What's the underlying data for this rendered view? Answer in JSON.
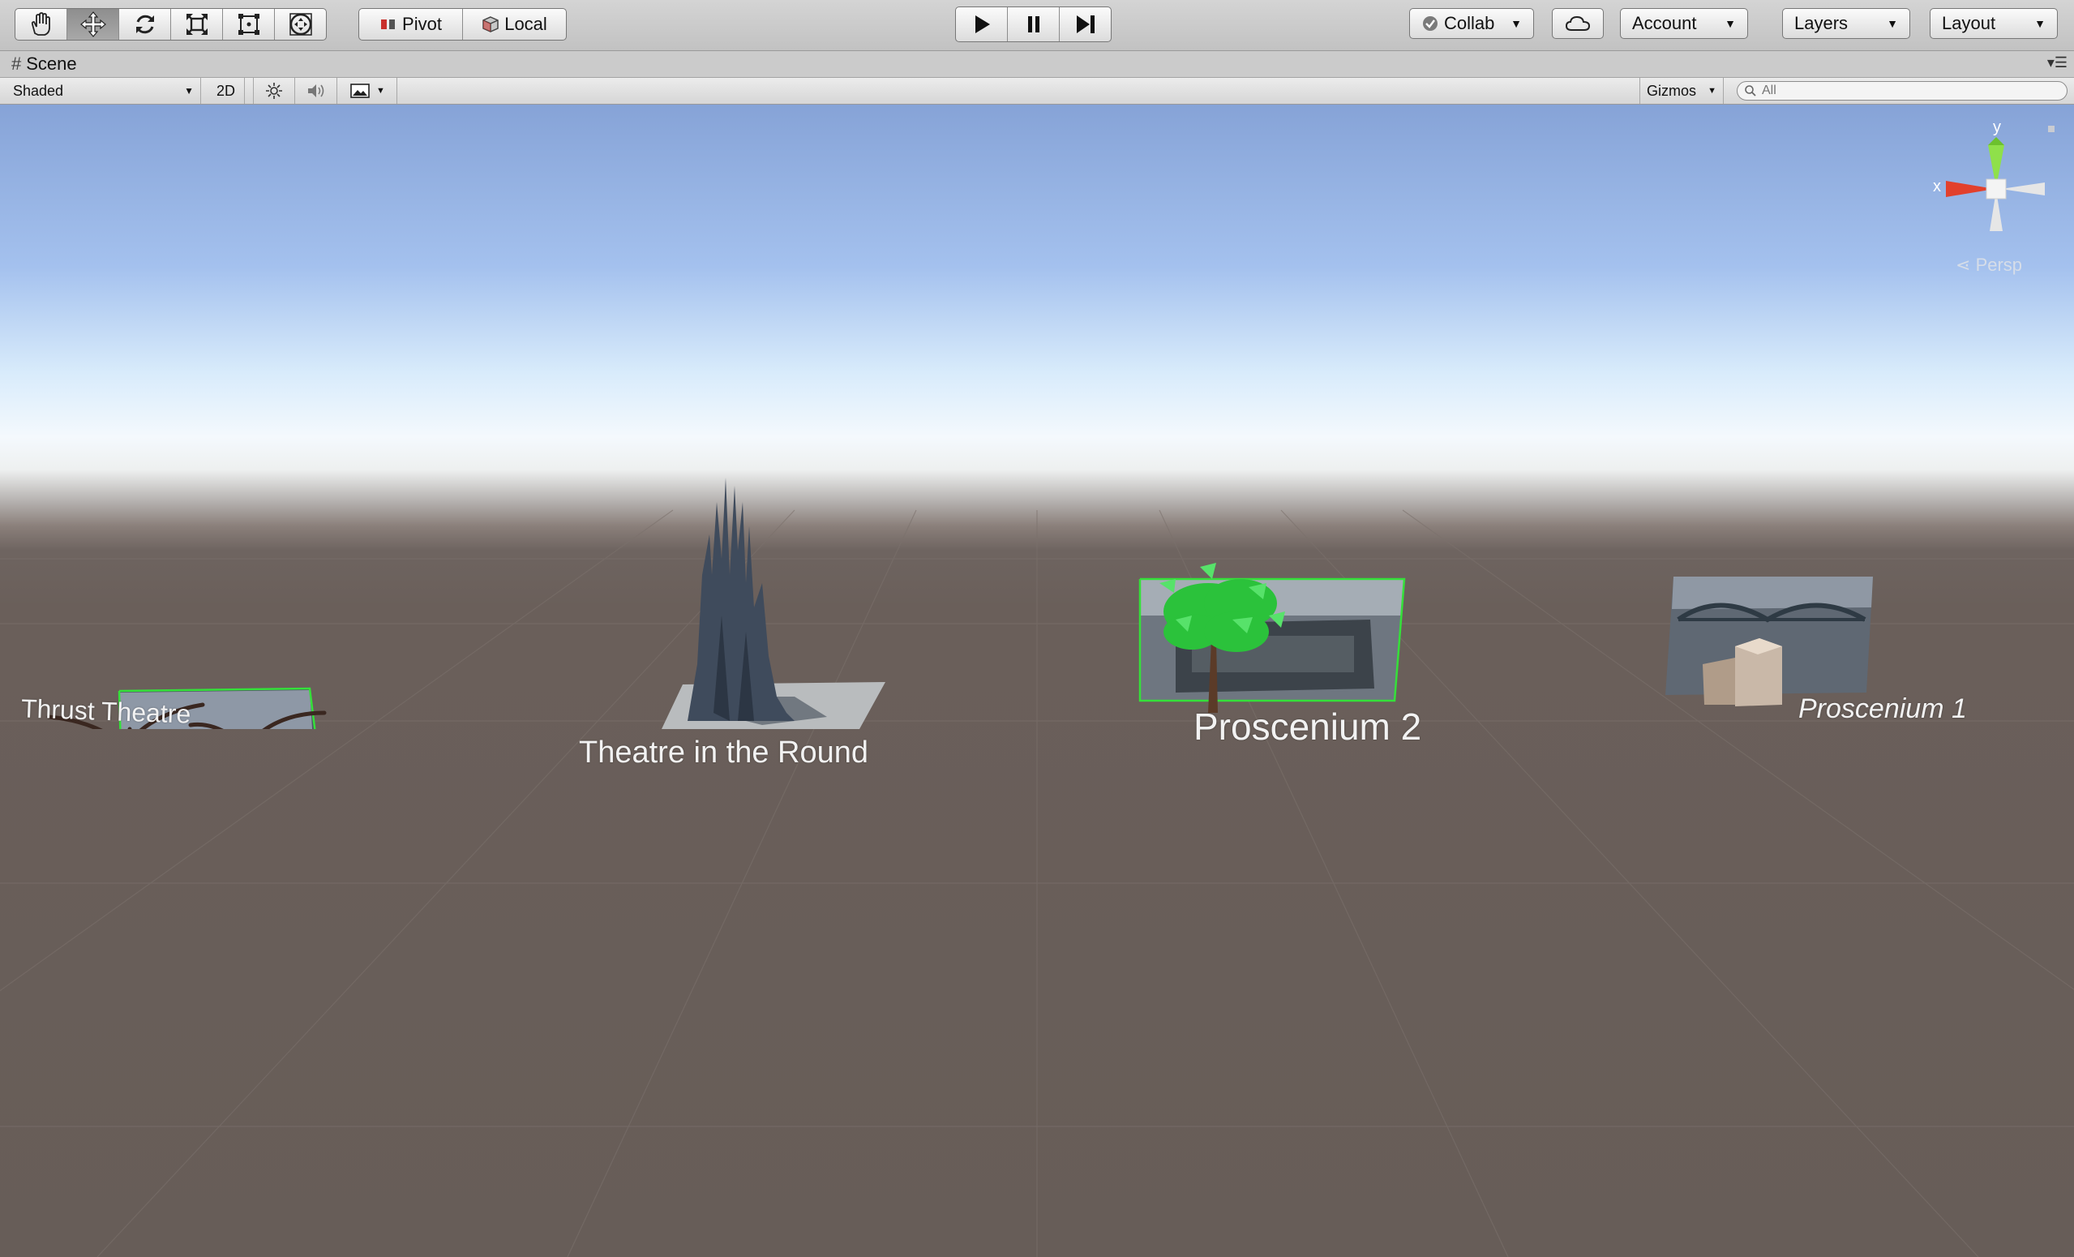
{
  "toolbar": {
    "tools": [
      {
        "name": "hand-tool",
        "icon": "hand-icon"
      },
      {
        "name": "move-tool",
        "icon": "move-arrows-icon",
        "active": true
      },
      {
        "name": "rotate-tool",
        "icon": "rotate-icon"
      },
      {
        "name": "scale-tool",
        "icon": "scale-icon"
      },
      {
        "name": "rect-tool",
        "icon": "rect-transform-icon"
      },
      {
        "name": "transform-tool",
        "icon": "transform-icon"
      }
    ],
    "pivot_label": "Pivot",
    "local_label": "Local",
    "play_icon": "play-icon",
    "pause_icon": "pause-icon",
    "step_icon": "step-icon",
    "collab_label": "Collab",
    "cloud_icon": "cloud-icon",
    "account_label": "Account",
    "layers_label": "Layers",
    "layout_label": "Layout"
  },
  "scene_tab": {
    "title": "Scene"
  },
  "scene_bar": {
    "shading_mode": "Shaded",
    "mode_2d": "2D",
    "lighting_icon": "sun-icon",
    "audio_icon": "speaker-icon",
    "effects_icon": "image-icon",
    "gizmos_label": "Gizmos",
    "search_placeholder": "All"
  },
  "viewport": {
    "labels": {
      "thrust": "Thrust Theatre",
      "round": "Theatre in the Round",
      "proscenium2": "Proscenium 2",
      "proscenium1": "Proscenium 1"
    },
    "gizmo": {
      "y_label": "y",
      "x_label": "x",
      "persp_label": "Persp"
    }
  },
  "colors": {
    "sky_top": "#86a3d7",
    "horizon": "#f4f9fd",
    "ground": "#6a5f5a",
    "gizmo_x": "#e2402c",
    "gizmo_y": "#7fd23a",
    "selection_outline": "#35e03a"
  }
}
